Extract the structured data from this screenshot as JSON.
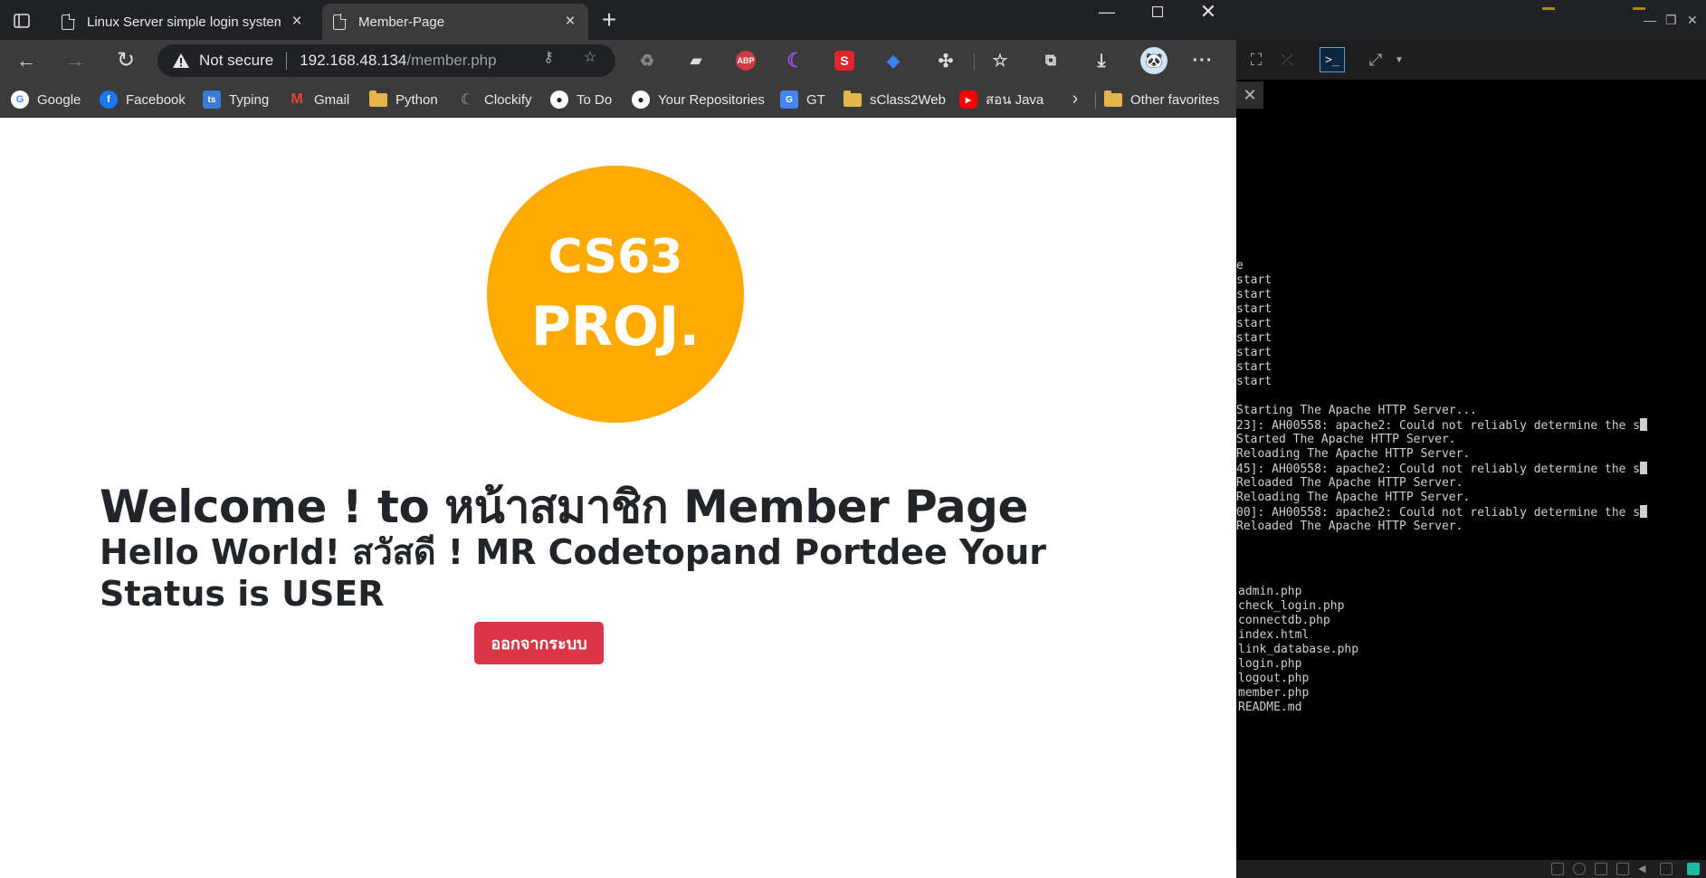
{
  "browser": {
    "tabs": [
      {
        "title": "Linux Server simple login system",
        "active": false
      },
      {
        "title": "Member-Page",
        "active": true
      }
    ],
    "url": {
      "security_label": "Not secure",
      "host": "192.168.48.134",
      "path": "/member.php"
    },
    "bookmarks": [
      {
        "label": "Google",
        "icon": "google-icon",
        "color": "#4285f4"
      },
      {
        "label": "Facebook",
        "icon": "facebook-icon",
        "color": "#1877f2"
      },
      {
        "label": "Typing",
        "icon": "typing-icon",
        "color": "#3a7bd5"
      },
      {
        "label": "Gmail",
        "icon": "gmail-icon",
        "color": "#ea4335"
      },
      {
        "label": "Python",
        "icon": "folder-icon",
        "color": "#e5b44a"
      },
      {
        "label": "Clockify",
        "icon": "clockify-icon",
        "color": "#777777"
      },
      {
        "label": "To Do",
        "icon": "github-icon",
        "color": "#ffffff"
      },
      {
        "label": "Your Repositories",
        "icon": "github-icon",
        "color": "#ffffff"
      },
      {
        "label": "GT",
        "icon": "google-translate-icon",
        "color": "#4285f4"
      },
      {
        "label": "sClass2Web",
        "icon": "folder-icon",
        "color": "#e5b44a"
      },
      {
        "label": "สอน Java",
        "icon": "youtube-icon",
        "color": "#ff0000"
      }
    ],
    "other_favorites": "Other favorites",
    "extensions": {
      "abp": "ABP",
      "s": "S"
    }
  },
  "page": {
    "logo": {
      "line1": "CS63",
      "line2": "PROJ.",
      "color": "#ffa903"
    },
    "welcome": "Welcome ! to หน้าสมาชิก Member Page",
    "hello": "Hello World! สวัสดี ! MR Codetopand Portdee Your Status is USER",
    "logout_button": "ออกจากระบบ",
    "button_color": "#dc3545"
  },
  "terminal": {
    "lines_top": [
      "e",
      "start",
      "start",
      "start",
      "start",
      "start",
      "start",
      "start",
      "start"
    ],
    "lines_mid": [
      "Starting The Apache HTTP Server...",
      "23]: AH00558: apache2: Could not reliably determine the s",
      "Started The Apache HTTP Server.",
      "Reloading The Apache HTTP Server.",
      "45]: AH00558: apache2: Could not reliably determine the s",
      "Reloaded The Apache HTTP Server.",
      "Reloading The Apache HTTP Server.",
      "00]: AH00558: apache2: Could not reliably determine the s",
      "Reloaded The Apache HTTP Server."
    ],
    "files": [
      "admin.php",
      "check_login.php",
      "connectdb.php",
      "index.html",
      "link_database.php",
      "login.php",
      "logout.php",
      "member.php",
      "README.md"
    ]
  }
}
